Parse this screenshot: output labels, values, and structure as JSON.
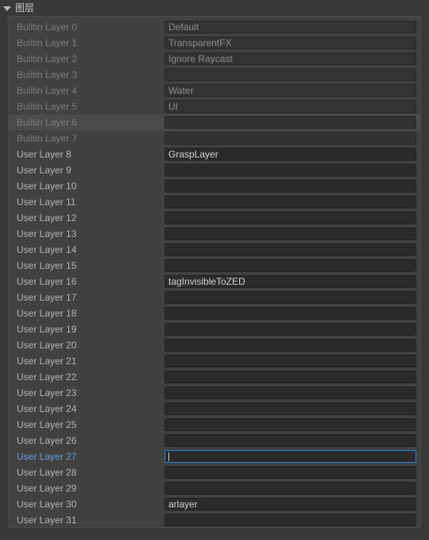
{
  "header": {
    "title": "图层",
    "expanded": true,
    "disclosure_icon": "triangle-down-icon"
  },
  "colors": {
    "window_background": "#393939",
    "panel_background": "#414141",
    "field_background": "#2b2b2b",
    "focus_accent": "#2f7fd4",
    "focus_label": "#6a9ee0",
    "hover_row": "#4b4b4b",
    "label_user": "#b4b4b4",
    "label_builtin": "#7c7c7c"
  },
  "layers": [
    {
      "label": "Builtin Layer 0",
      "value": "Default",
      "kind": "builtin",
      "hovered": false,
      "focused": false
    },
    {
      "label": "Builtin Layer 1",
      "value": "TransparentFX",
      "kind": "builtin",
      "hovered": false,
      "focused": false
    },
    {
      "label": "Builtin Layer 2",
      "value": "Ignore Raycast",
      "kind": "builtin",
      "hovered": false,
      "focused": false
    },
    {
      "label": "Builtin Layer 3",
      "value": "",
      "kind": "builtin",
      "hovered": false,
      "focused": false
    },
    {
      "label": "Builtin Layer 4",
      "value": "Water",
      "kind": "builtin",
      "hovered": false,
      "focused": false
    },
    {
      "label": "Builtin Layer 5",
      "value": "UI",
      "kind": "builtin",
      "hovered": false,
      "focused": false
    },
    {
      "label": "Builtin Layer 6",
      "value": "",
      "kind": "builtin",
      "hovered": true,
      "focused": false
    },
    {
      "label": "Builtin Layer 7",
      "value": "",
      "kind": "builtin",
      "hovered": false,
      "focused": false
    },
    {
      "label": "User Layer 8",
      "value": "GraspLayer",
      "kind": "user",
      "hovered": false,
      "focused": false
    },
    {
      "label": "User Layer 9",
      "value": "",
      "kind": "user",
      "hovered": false,
      "focused": false
    },
    {
      "label": "User Layer 10",
      "value": "",
      "kind": "user",
      "hovered": false,
      "focused": false
    },
    {
      "label": "User Layer 11",
      "value": "",
      "kind": "user",
      "hovered": false,
      "focused": false
    },
    {
      "label": "User Layer 12",
      "value": "",
      "kind": "user",
      "hovered": false,
      "focused": false
    },
    {
      "label": "User Layer 13",
      "value": "",
      "kind": "user",
      "hovered": false,
      "focused": false
    },
    {
      "label": "User Layer 14",
      "value": "",
      "kind": "user",
      "hovered": false,
      "focused": false
    },
    {
      "label": "User Layer 15",
      "value": "",
      "kind": "user",
      "hovered": false,
      "focused": false
    },
    {
      "label": "User Layer 16",
      "value": "tagInvisibleToZED",
      "kind": "user",
      "hovered": false,
      "focused": false
    },
    {
      "label": "User Layer 17",
      "value": "",
      "kind": "user",
      "hovered": false,
      "focused": false
    },
    {
      "label": "User Layer 18",
      "value": "",
      "kind": "user",
      "hovered": false,
      "focused": false
    },
    {
      "label": "User Layer 19",
      "value": "",
      "kind": "user",
      "hovered": false,
      "focused": false
    },
    {
      "label": "User Layer 20",
      "value": "",
      "kind": "user",
      "hovered": false,
      "focused": false
    },
    {
      "label": "User Layer 21",
      "value": "",
      "kind": "user",
      "hovered": false,
      "focused": false
    },
    {
      "label": "User Layer 22",
      "value": "",
      "kind": "user",
      "hovered": false,
      "focused": false
    },
    {
      "label": "User Layer 23",
      "value": "",
      "kind": "user",
      "hovered": false,
      "focused": false
    },
    {
      "label": "User Layer 24",
      "value": "",
      "kind": "user",
      "hovered": false,
      "focused": false
    },
    {
      "label": "User Layer 25",
      "value": "",
      "kind": "user",
      "hovered": false,
      "focused": false
    },
    {
      "label": "User Layer 26",
      "value": "",
      "kind": "user",
      "hovered": false,
      "focused": false
    },
    {
      "label": "User Layer 27",
      "value": "",
      "kind": "user",
      "hovered": false,
      "focused": true
    },
    {
      "label": "User Layer 28",
      "value": "",
      "kind": "user",
      "hovered": false,
      "focused": false
    },
    {
      "label": "User Layer 29",
      "value": "",
      "kind": "user",
      "hovered": false,
      "focused": false
    },
    {
      "label": "User Layer 30",
      "value": "arlayer",
      "kind": "user",
      "hovered": false,
      "focused": false
    },
    {
      "label": "User Layer 31",
      "value": "",
      "kind": "user",
      "hovered": false,
      "focused": false
    }
  ]
}
